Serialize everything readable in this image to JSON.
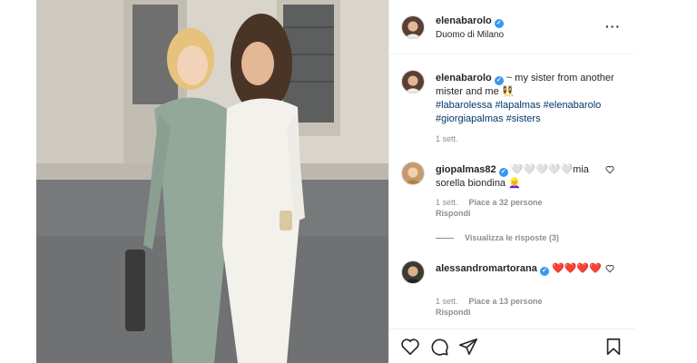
{
  "post": {
    "author": "elenabarolo",
    "location": "Duomo di Milano",
    "caption_text": " ~ my sister from another mister and me 👯‍♀️",
    "hashtags": [
      "#labarolessa",
      "#lapalmas",
      "#elenabarolo",
      "#giorgiapalmas",
      "#sisters"
    ],
    "caption_time": "1 sett."
  },
  "comments": [
    {
      "username": "giopalmas82",
      "text": " 🤍🤍🤍🤍🤍mia sorella biondina 👱‍♀️",
      "time": "1 sett.",
      "likes": "Piace a 32 persone",
      "reply": "Rispondi"
    },
    {
      "username": "alessandromartorana",
      "text": " ❤️❤️❤️❤️",
      "time": "1 sett.",
      "likes": "Piace a 13 persone",
      "reply": "Rispondi"
    }
  ],
  "view_replies": "Visualizza le risposte (3)",
  "icons": {
    "verified": "verified-badge",
    "more": "more-options-icon",
    "like": "heart-icon",
    "comment": "comment-icon",
    "share": "share-icon",
    "save": "bookmark-icon"
  },
  "colors": {
    "verified": "#3897f0",
    "hashtag": "#00376b",
    "muted": "#8e8e8e"
  }
}
